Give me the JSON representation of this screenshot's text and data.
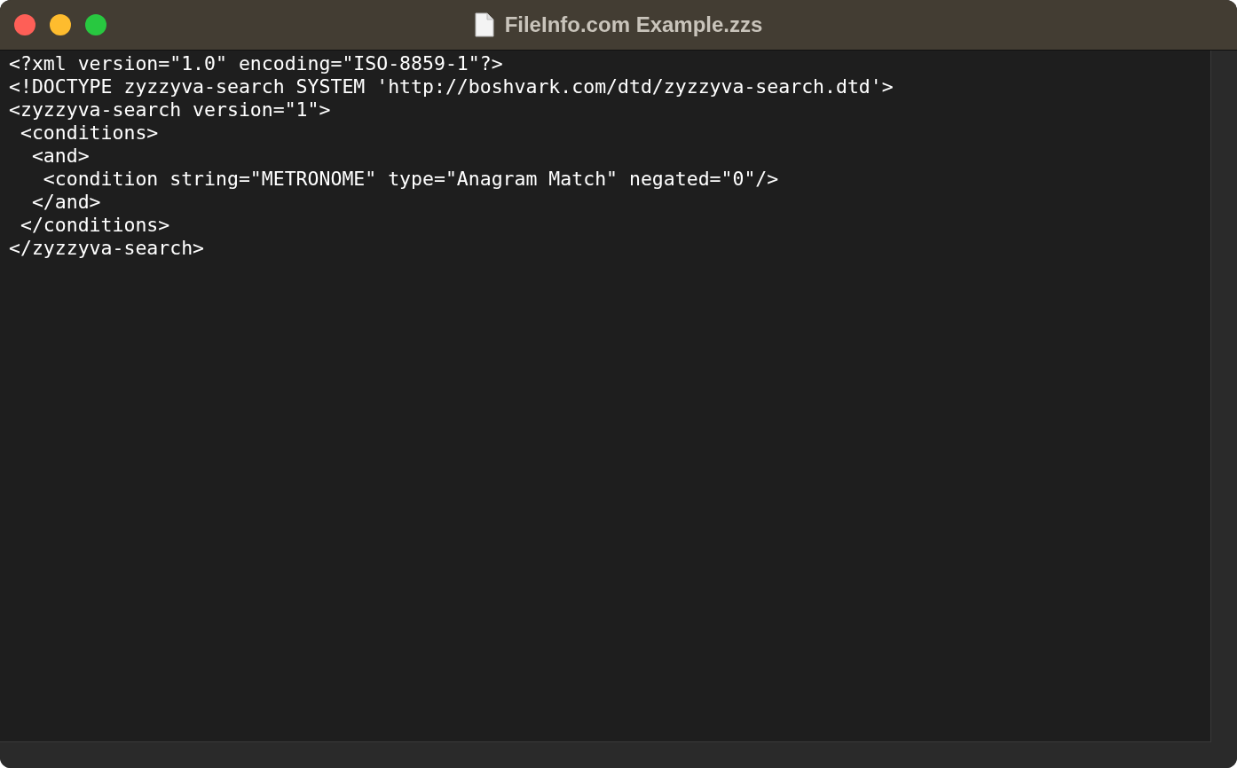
{
  "window": {
    "title": "FileInfo.com Example.zzs"
  },
  "editor": {
    "lines": [
      "<?xml version=\"1.0\" encoding=\"ISO-8859-1\"?>",
      "<!DOCTYPE zyzzyva-search SYSTEM 'http://boshvark.com/dtd/zyzzyva-search.dtd'>",
      "<zyzzyva-search version=\"1\">",
      " <conditions>",
      "  <and>",
      "   <condition string=\"METRONOME\" type=\"Anagram Match\" negated=\"0\"/>",
      "  </and>",
      " </conditions>",
      "</zyzzyva-search>"
    ]
  }
}
